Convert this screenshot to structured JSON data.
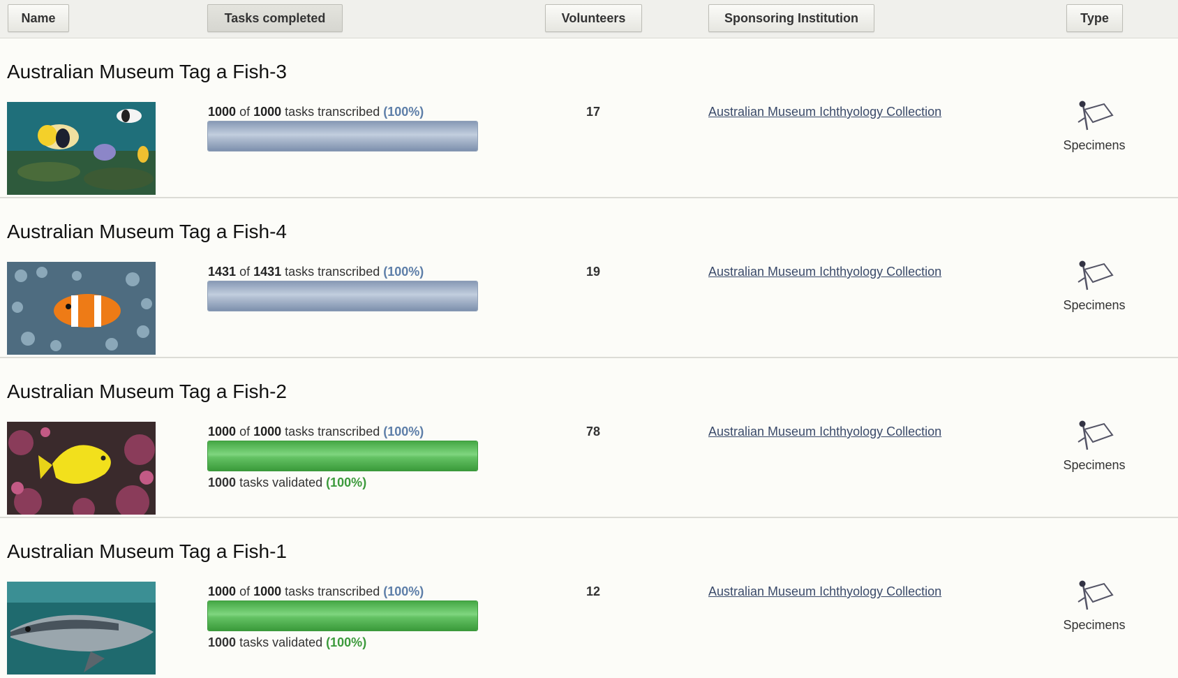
{
  "header": {
    "name_label": "Name",
    "tasks_label": "Tasks completed",
    "volunteers_label": "Volunteers",
    "institution_label": "Sponsoring Institution",
    "type_label": "Type",
    "active_sort": "tasks"
  },
  "colors": {
    "transcribed_bar": "#9eb0c8",
    "validated_bar": "#4fb44f",
    "percent_blue": "#5d7ea8",
    "percent_green": "#3c9a3c"
  },
  "rows": [
    {
      "name": "Australian Museum Tag a Fish-3",
      "image": "fish-butterflyfish-reef",
      "transcribed_done": "1000",
      "of_word": "of",
      "transcribed_total": "1000",
      "transcribed_text": "tasks transcribed",
      "transcribed_pct": "(100%)",
      "transcribed_progress": 1.0,
      "bar_color": "blue",
      "validated_count": "",
      "validated_text": "",
      "validated_pct": "",
      "volunteers": "17",
      "institution": "Australian Museum Ichthyology Collection",
      "type_icon": "specimen-tag-icon",
      "type": "Specimens"
    },
    {
      "name": "Australian Museum Tag a Fish-4",
      "image": "fish-clownfish-anemone",
      "transcribed_done": "1431",
      "of_word": "of",
      "transcribed_total": "1431",
      "transcribed_text": "tasks transcribed",
      "transcribed_pct": "(100%)",
      "transcribed_progress": 1.0,
      "bar_color": "blue",
      "validated_count": "",
      "validated_text": "",
      "validated_pct": "",
      "volunteers": "19",
      "institution": "Australian Museum Ichthyology Collection",
      "type_icon": "specimen-tag-icon",
      "type": "Specimens"
    },
    {
      "name": "Australian Museum Tag a Fish-2",
      "image": "fish-yellow-tang",
      "transcribed_done": "1000",
      "of_word": "of",
      "transcribed_total": "1000",
      "transcribed_text": "tasks transcribed",
      "transcribed_pct": "(100%)",
      "transcribed_progress": 1.0,
      "bar_color": "green",
      "validated_count": "1000",
      "validated_text": "tasks validated",
      "validated_pct": "(100%)",
      "volunteers": "78",
      "institution": "Australian Museum Ichthyology Collection",
      "type_icon": "specimen-tag-icon",
      "type": "Specimens"
    },
    {
      "name": "Australian Museum Tag a Fish-1",
      "image": "fish-tuna",
      "transcribed_done": "1000",
      "of_word": "of",
      "transcribed_total": "1000",
      "transcribed_text": "tasks transcribed",
      "transcribed_pct": "(100%)",
      "transcribed_progress": 1.0,
      "bar_color": "green",
      "validated_count": "1000",
      "validated_text": "tasks validated",
      "validated_pct": "(100%)",
      "volunteers": "12",
      "institution": "Australian Museum Ichthyology Collection",
      "type_icon": "specimen-tag-icon",
      "type": "Specimens"
    }
  ]
}
